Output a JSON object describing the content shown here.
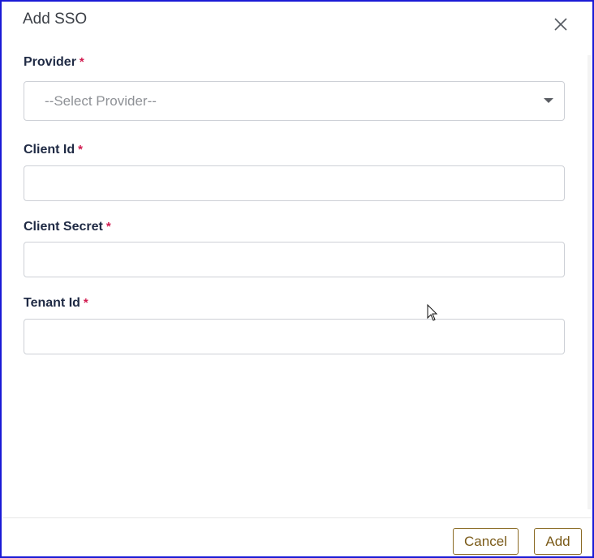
{
  "dialog": {
    "title": "Add SSO",
    "close_icon": "close-icon"
  },
  "form": {
    "required_marker": "*",
    "provider": {
      "label": "Provider",
      "selected": "--Select Provider--"
    },
    "client_id": {
      "label": "Client Id",
      "value": ""
    },
    "client_secret": {
      "label": "Client Secret",
      "value": ""
    },
    "tenant_id": {
      "label": "Tenant Id",
      "value": ""
    }
  },
  "footer": {
    "cancel_label": "Cancel",
    "add_label": "Add"
  },
  "colors": {
    "accent": "#7a5a18",
    "required": "#d11b4f",
    "border": "#1a1ad6"
  }
}
